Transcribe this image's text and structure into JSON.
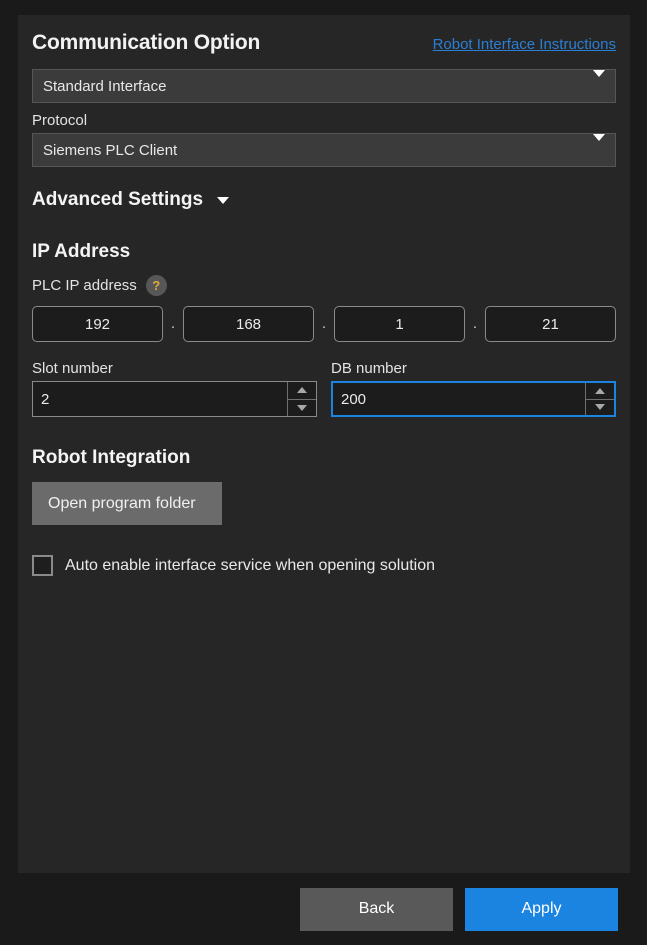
{
  "panel": {
    "communication": {
      "title": "Communication Option",
      "instructions_link": "Robot Interface Instructions",
      "interface_value": "Standard Interface",
      "protocol_label": "Protocol",
      "protocol_value": "Siemens PLC Client"
    },
    "advanced": {
      "title": "Advanced Settings",
      "chevron_icon": "chevron-down-icon"
    },
    "ip_address": {
      "title": "IP Address",
      "plc_label": "PLC IP address",
      "help_icon": "question-mark-icon",
      "help_glyph": "?",
      "octets": [
        "192",
        "168",
        "1",
        "21"
      ],
      "separator": ".",
      "slot_label": "Slot number",
      "slot_value": "2",
      "db_label": "DB number",
      "db_value": "200"
    },
    "robot_integration": {
      "title": "Robot Integration",
      "open_folder_label": "Open program folder",
      "auto_enable_label": "Auto enable interface service when opening solution",
      "auto_enable_checked": false
    }
  },
  "footer": {
    "back_label": "Back",
    "apply_label": "Apply"
  },
  "colors": {
    "accent_blue": "#1a84e0",
    "link_blue": "#2a7fd4",
    "panel_bg": "#262626",
    "window_bg": "#1a1a1a",
    "help_yellow": "#e0a83a"
  }
}
